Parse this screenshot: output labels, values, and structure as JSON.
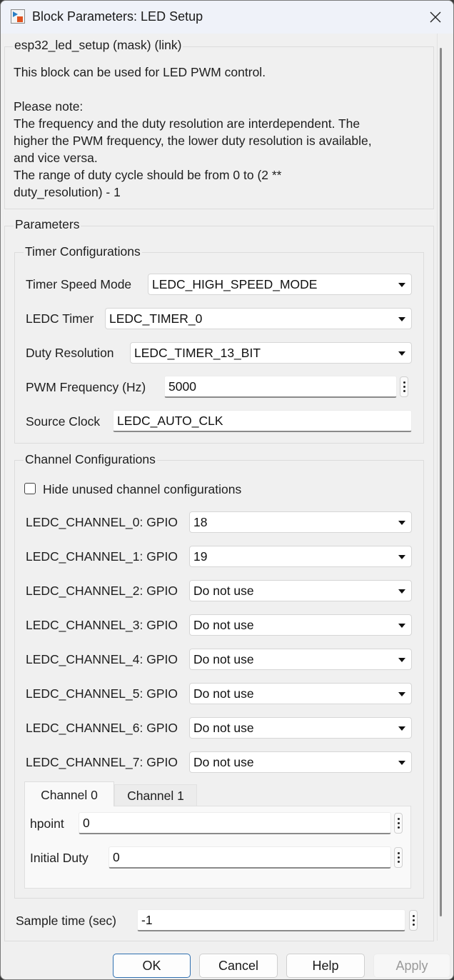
{
  "window": {
    "title": "Block Parameters: LED Setup",
    "icon": "simulink-block-icon",
    "close_icon": "close-icon"
  },
  "description": {
    "group_title": "esp32_led_setup (mask) (link)",
    "lines": [
      "This block can be used for LED PWM control.",
      "",
      "Please note:",
      "The frequency and the duty resolution are interdependent. The",
      "higher the PWM frequency, the lower duty resolution is available,",
      "and vice versa.",
      "The range of duty cycle should be from 0 to (2 **",
      "duty_resolution) - 1"
    ]
  },
  "parameters": {
    "group_title": "Parameters",
    "timer": {
      "group_title": "Timer Configurations",
      "speed_mode": {
        "label": "Timer Speed Mode",
        "value": "LEDC_HIGH_SPEED_MODE"
      },
      "ledc_timer": {
        "label": "LEDC Timer",
        "value": "LEDC_TIMER_0"
      },
      "duty_resolution": {
        "label": "Duty Resolution",
        "value": "LEDC_TIMER_13_BIT"
      },
      "pwm_frequency": {
        "label": "PWM Frequency (Hz)",
        "value": "5000"
      },
      "source_clock": {
        "label": "Source Clock",
        "value": "LEDC_AUTO_CLK"
      }
    },
    "channel": {
      "group_title": "Channel Configurations",
      "hide_unused": {
        "label": "Hide unused channel configurations",
        "checked": false
      },
      "channels": [
        {
          "label": "LEDC_CHANNEL_0: GPIO",
          "value": "18"
        },
        {
          "label": "LEDC_CHANNEL_1: GPIO",
          "value": "19"
        },
        {
          "label": "LEDC_CHANNEL_2: GPIO",
          "value": "Do not use"
        },
        {
          "label": "LEDC_CHANNEL_3: GPIO",
          "value": "Do not use"
        },
        {
          "label": "LEDC_CHANNEL_4: GPIO",
          "value": "Do not use"
        },
        {
          "label": "LEDC_CHANNEL_5: GPIO",
          "value": "Do not use"
        },
        {
          "label": "LEDC_CHANNEL_6: GPIO",
          "value": "Do not use"
        },
        {
          "label": "LEDC_CHANNEL_7: GPIO",
          "value": "Do not use"
        }
      ],
      "tabs": [
        {
          "label": "Channel 0",
          "active": true
        },
        {
          "label": "Channel 1",
          "active": false
        }
      ],
      "hpoint": {
        "label": "hpoint",
        "value": "0"
      },
      "initial_duty": {
        "label": "Initial Duty",
        "value": "0"
      }
    },
    "sample_time": {
      "label": "Sample time (sec)",
      "value": "-1"
    }
  },
  "buttons": {
    "ok": "OK",
    "cancel": "Cancel",
    "help": "Help",
    "apply": "Apply"
  }
}
